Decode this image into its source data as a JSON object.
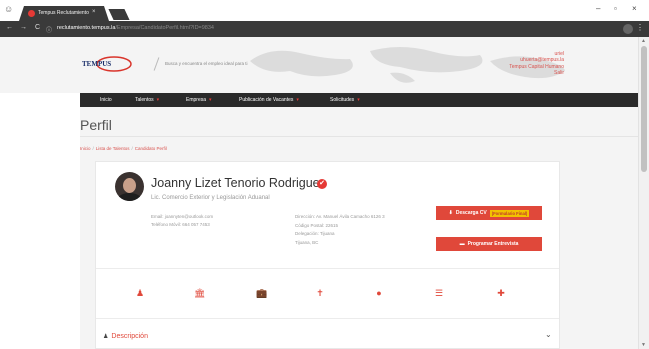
{
  "browser": {
    "tab_title": "Tempus Reclutamiento",
    "tab_close": "×",
    "url_host": "reclutamiento.tempus.la",
    "url_path": "/Empresa/CandidatoPerfil.html?ID=9834",
    "minimize": "–",
    "restore": "▫",
    "close": "×",
    "back": "←",
    "forward": "→",
    "reload": "C",
    "menu": "⋮"
  },
  "header": {
    "logo_text": "TEMPUS",
    "tagline": "Busca y encuentra el empleo ideal para ti",
    "user": {
      "name": "uriel",
      "email": "uhuerta@tempus.la",
      "company": "Tempus Capital Humano",
      "logout": "Salir"
    }
  },
  "nav": [
    {
      "label": "Inicio",
      "caret": ""
    },
    {
      "label": "Talentos",
      "caret": "▾"
    },
    {
      "label": "Empresa",
      "caret": "▾"
    },
    {
      "label": "Publicación de Vacantes",
      "caret": "▾"
    },
    {
      "label": "Solicitudes",
      "caret": "▾"
    }
  ],
  "page": {
    "title": "Perfil",
    "breadcrumb": [
      "Inicio",
      "Lista de Talentos",
      "Candidato Perfil"
    ],
    "breadcrumb_sep": "/"
  },
  "profile": {
    "name": "Joanny Lizet Tenorio Rodriguez",
    "verified_glyph": "✔",
    "title": "Lic. Comercio Exterior y Legislación Aduanal",
    "email": "Email: joannyten@outlook.com",
    "phone": "Teléfono Móvil: 664 057 7453",
    "address": "Dirección: Av. Manuel Ávila Camacho 6126 3",
    "postal_code": "Código Postal: 22615",
    "delegation": "Delegación: Tijuana",
    "city": "Tijuana, BC"
  },
  "actions": {
    "download_cv": "Descarga CV",
    "download_badge": "(Formulario Final)",
    "download_icon": "⬇",
    "schedule_interview": "Programar Entrevista",
    "schedule_icon": "▬"
  },
  "section_icons": [
    {
      "name": "person-icon",
      "glyph": "♟"
    },
    {
      "name": "institution-icon",
      "glyph": "🏛"
    },
    {
      "name": "briefcase-icon",
      "glyph": "💼"
    },
    {
      "name": "figure-icon",
      "glyph": "✝"
    },
    {
      "name": "globe-icon",
      "glyph": "●"
    },
    {
      "name": "list-icon",
      "glyph": "☰"
    },
    {
      "name": "plus-icon",
      "glyph": "✚"
    }
  ],
  "description": {
    "label": "Descripción",
    "icon": "♟",
    "chevron": "⌄"
  },
  "colors": {
    "accent": "#e0483a",
    "nav_bg": "#2a2a2a",
    "chrome_bg": "#3a3a3a"
  }
}
